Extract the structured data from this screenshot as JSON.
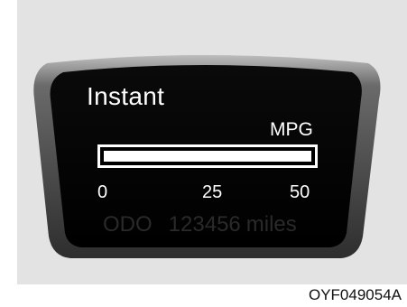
{
  "display": {
    "mode_title": "Instant",
    "unit_label": "MPG",
    "fuel_economy_bar": {
      "scale_min": 0,
      "scale_max": 50,
      "fill_fraction": 1.0
    },
    "scale_ticks": [
      "0",
      "25",
      "50"
    ],
    "odometer": {
      "label": "ODO",
      "value": "123456",
      "unit": "miles"
    }
  },
  "figure_code": "OYF049054A",
  "colors": {
    "panel_background": "#e3e3e3",
    "screen": "#000000",
    "text": "#ffffff",
    "odo_text": "#2a2a2a"
  }
}
